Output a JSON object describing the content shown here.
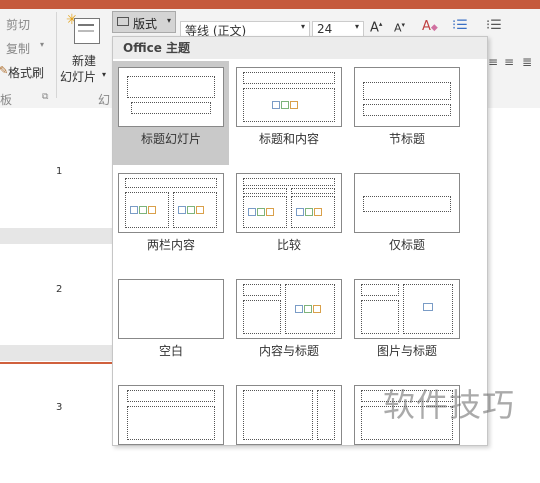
{
  "ribbon": {
    "cut": "剪切",
    "copy": "复制",
    "format_painter": "格式刷",
    "clipboard_label": "板",
    "new_slide_line1": "新建",
    "new_slide_line2": "幻灯片",
    "slides_group_partial": "幻",
    "layout_button": "版式",
    "font_name": "等线 (正文)",
    "font_size": "24"
  },
  "slides_pane": {
    "numbers": [
      "1",
      "2",
      "3"
    ]
  },
  "layout_dropdown": {
    "header": "Office 主题",
    "items": [
      {
        "label": "标题幻灯片",
        "selected": true
      },
      {
        "label": "标题和内容"
      },
      {
        "label": "节标题"
      },
      {
        "label": "两栏内容"
      },
      {
        "label": "比较"
      },
      {
        "label": "仅标题"
      },
      {
        "label": "空白"
      },
      {
        "label": "内容与标题"
      },
      {
        "label": "图片与标题"
      }
    ]
  },
  "watermark": "软件技巧",
  "colors": {
    "accent": "#c55a3c",
    "selected_bg": "#c9c9c9"
  }
}
